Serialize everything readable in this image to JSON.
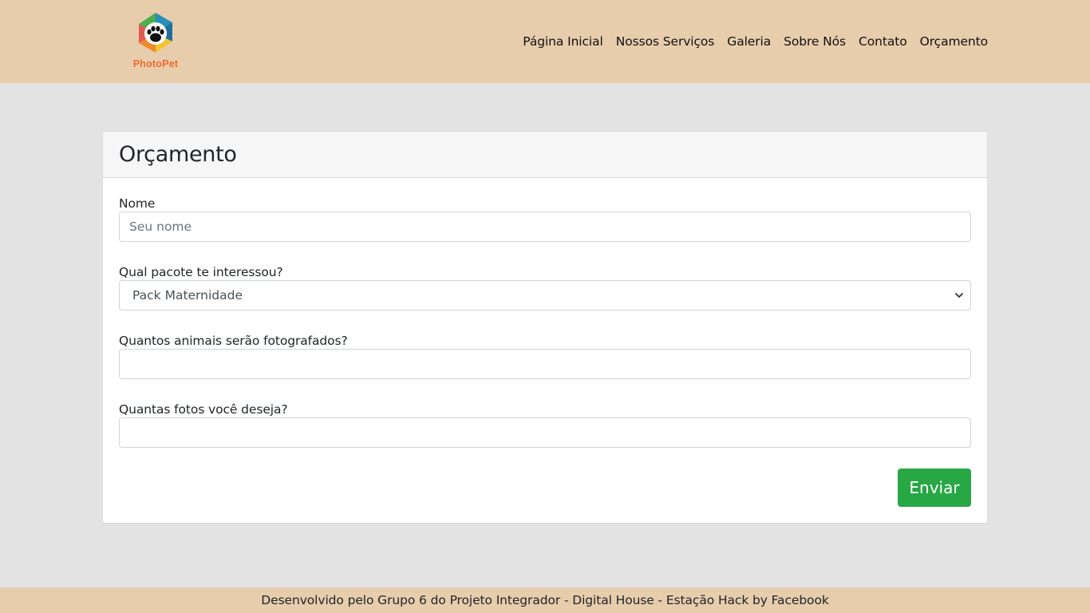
{
  "brand": {
    "name": "PhotoPet",
    "logo_icon": "paw-hexagon-logo"
  },
  "nav": {
    "items": [
      {
        "label": "Página Inicial"
      },
      {
        "label": "Nossos Serviços"
      },
      {
        "label": "Galeria"
      },
      {
        "label": "Sobre Nós"
      },
      {
        "label": "Contato"
      },
      {
        "label": "Orçamento"
      }
    ]
  },
  "form": {
    "title": "Orçamento",
    "name_label": "Nome",
    "name_placeholder": "Seu nome",
    "package_label": "Qual pacote te interessou?",
    "package_selected": "Pack Maternidade",
    "animals_label": "Quantos animais serão fotografados?",
    "animals_value": "",
    "photos_label": "Quantas fotos você deseja?",
    "photos_value": "",
    "submit_label": "Enviar"
  },
  "footer": {
    "text": "Desenvolvido pelo Grupo 6 do Projeto Integrador - Digital House - Estação Hack by Facebook"
  },
  "colors": {
    "header_bg": "#e8cdad",
    "page_bg": "#e3e3e3",
    "submit_bg": "#28a745",
    "logo_text": "#ef6a2c"
  }
}
